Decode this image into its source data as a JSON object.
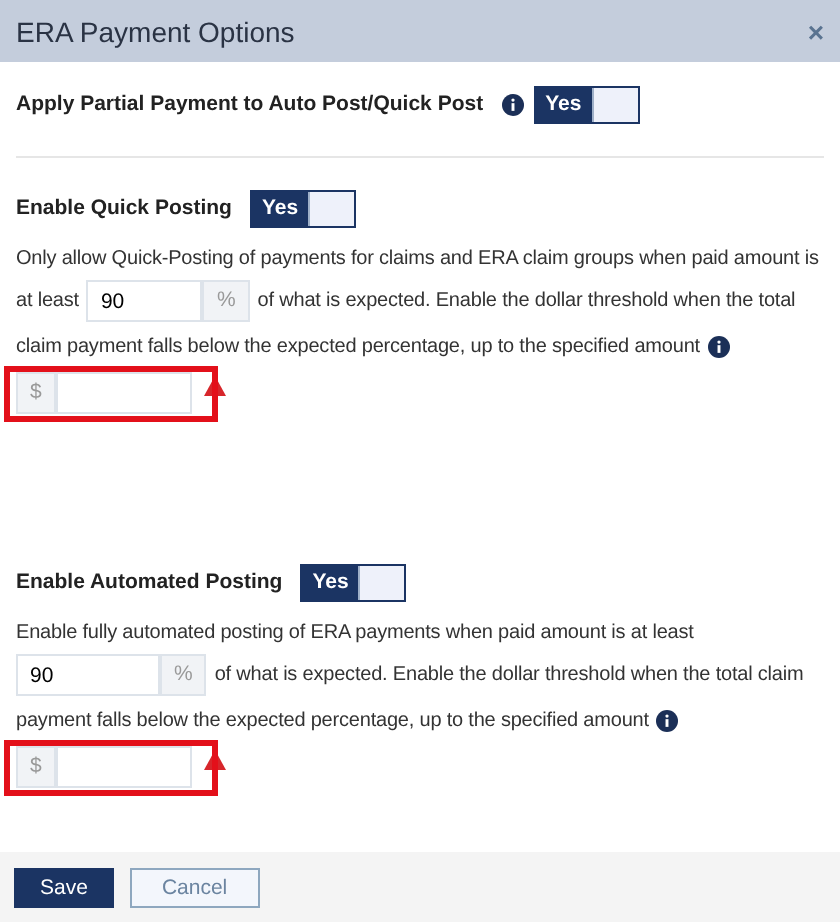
{
  "dialog": {
    "title": "ERA Payment Options",
    "close": "×"
  },
  "partial_payment": {
    "label": "Apply Partial Payment to Auto Post/Quick Post",
    "toggle": {
      "label": "Yes",
      "on": true
    }
  },
  "sections": [
    {
      "title": "Enable Quick Posting",
      "toggle": {
        "label": "Yes",
        "on": true
      },
      "first_line": "Only allow Quick-Posting of payments for claims and ERA claim groups when paid amount is",
      "before_field": "at least",
      "percent_value": "90",
      "percent_unit": "%",
      "after_field": "of what is expected. Enable the dollar threshold when the total",
      "last_line": "claim payment falls below the expected percentage, up to the specified amount",
      "dollar_unit": "$",
      "warning": true,
      "highlighted": true
    },
    {
      "title": "Enable Automated Posting",
      "toggle": {
        "label": "Yes",
        "on": true
      },
      "first_line": "Enable fully automated posting of ERA payments when paid amount is at least",
      "percent_value": "90",
      "percent_unit": "%",
      "after_field": "of what is expected. Enable the dollar threshold when the total claim",
      "last_line": "payment falls below the expected percentage, up to the specified amount",
      "dollar_unit": "$",
      "warning": true,
      "highlighted": true
    }
  ],
  "buttons": [
    {
      "label": "Save",
      "kind": "primary"
    },
    {
      "label": "Cancel",
      "kind": "secondary"
    }
  ]
}
